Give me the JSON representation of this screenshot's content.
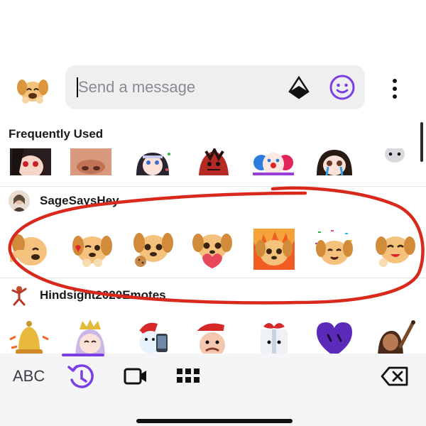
{
  "message_bar": {
    "input_placeholder": "Send a message",
    "input_value": "",
    "icons": [
      "sticker-toggle-icon",
      "bits-icon",
      "emote-picker-icon",
      "more-icon"
    ]
  },
  "emote_picker": {
    "frequently_used_title": "Frequently Used",
    "channels": [
      {
        "name": "SageSaysHey"
      },
      {
        "name": "Hindsight2020Emotes"
      }
    ]
  },
  "bottom_bar": {
    "abc_label": "ABC",
    "active_tab": "recent"
  },
  "colors": {
    "accent": "#7b3fe4",
    "annotation": "#d9281c",
    "input_bg": "#efeff1"
  }
}
